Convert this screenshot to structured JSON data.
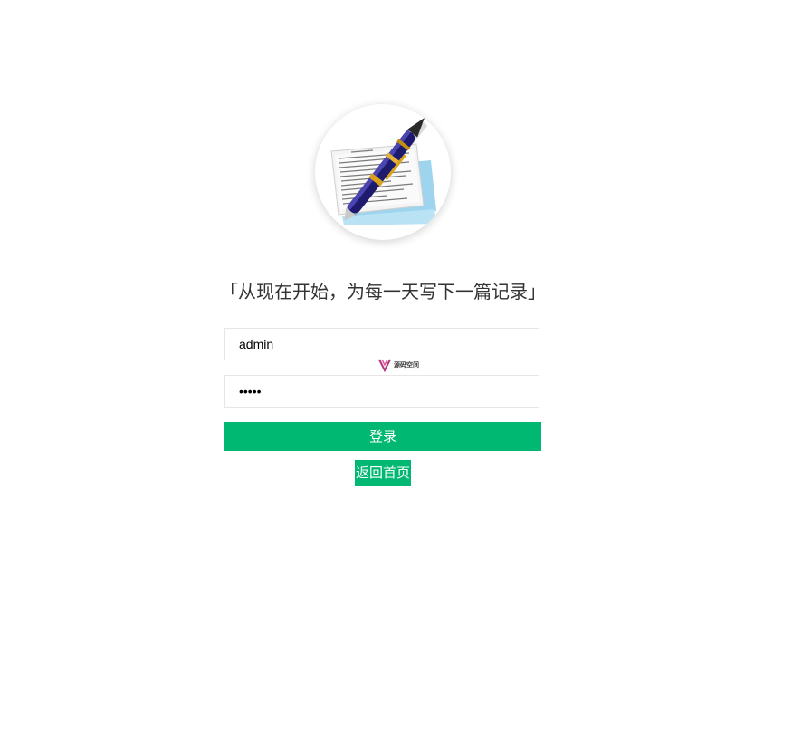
{
  "logo": {
    "icon": "document-pen-icon"
  },
  "slogan": "「从现在开始，为每一天写下一篇记录」",
  "form": {
    "username_value": "admin",
    "password_value": "•••••",
    "login_label": "登录",
    "back_label": "返回首页"
  },
  "watermark": {
    "text": "源码空间",
    "icon": "y-logo-icon"
  },
  "colors": {
    "accent": "#00b871",
    "text": "#333333",
    "border": "#e6e6e6",
    "background": "#ffffff"
  }
}
